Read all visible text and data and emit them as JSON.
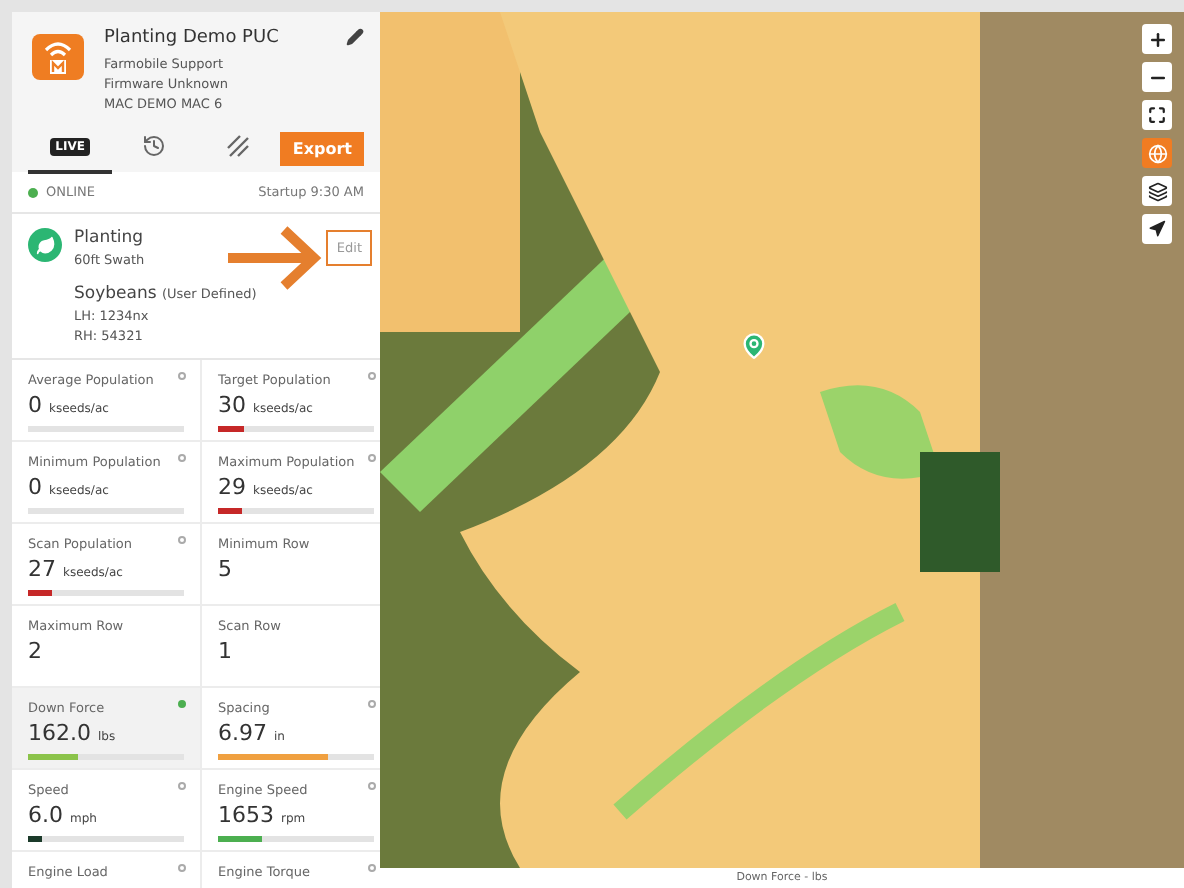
{
  "device": {
    "name": "Planting Demo PUC",
    "lines": [
      "Farmobile Support",
      "Firmware Unknown",
      "MAC DEMO MAC 6"
    ]
  },
  "tabs": [
    {
      "kind": "live",
      "label": "LIVE",
      "selected": true
    },
    {
      "kind": "history",
      "selected": false
    },
    {
      "kind": "coverage",
      "selected": false
    }
  ],
  "export_button": "Export",
  "status": {
    "online": true,
    "label": "ONLINE",
    "startup": "Startup 9:30 AM"
  },
  "operation": {
    "name": "Planting",
    "swath": "60ft Swath",
    "edit": "Edit",
    "crop": "Soybeans",
    "crop_note": "(User Defined)",
    "lines": [
      "LH: 1234nx",
      "RH: 54321"
    ]
  },
  "metrics": [
    {
      "kind": "empty_bar",
      "label": "Average Population",
      "value": "0",
      "unit": "kseeds/ac",
      "active": false,
      "selected": false
    },
    {
      "kind": "bar",
      "label": "Target Population",
      "value": "30",
      "unit": "kseeds/ac",
      "level": 0.17,
      "color": "#c62828",
      "active": false,
      "selected": false
    },
    {
      "kind": "empty_bar",
      "label": "Minimum Population",
      "value": "0",
      "unit": "kseeds/ac",
      "active": false,
      "selected": false
    },
    {
      "kind": "bar",
      "label": "Maximum Population",
      "value": "29",
      "unit": "kseeds/ac",
      "level": 0.16,
      "color": "#c62828",
      "active": false,
      "selected": false
    },
    {
      "kind": "bar",
      "label": "Scan Population",
      "value": "27",
      "unit": "kseeds/ac",
      "level": 0.15,
      "color": "#c62828",
      "active": false,
      "selected": false
    },
    {
      "kind": "plain",
      "label": "Minimum Row",
      "value": "5",
      "selected": false
    },
    {
      "kind": "plain",
      "label": "Maximum Row",
      "value": "2",
      "selected": false
    },
    {
      "kind": "plain",
      "label": "Scan Row",
      "value": "1",
      "selected": false
    },
    {
      "kind": "bar",
      "label": "Down Force",
      "value": "162.0",
      "unit": "lbs",
      "level": 0.32,
      "color": "#8bc34a",
      "active": true,
      "selected": true
    },
    {
      "kind": "bar",
      "label": "Spacing",
      "value": "6.97",
      "unit": "in",
      "level": 0.7,
      "color": "#f0a040",
      "active": false,
      "selected": false
    },
    {
      "kind": "bar",
      "label": "Speed",
      "value": "6.0",
      "unit": "mph",
      "level": 0.09,
      "color": "#1b3a2a",
      "active": false,
      "selected": false
    },
    {
      "kind": "bar",
      "label": "Engine Speed",
      "value": "1653",
      "unit": "rpm",
      "level": 0.28,
      "color": "#4caf50",
      "active": false,
      "selected": false
    },
    {
      "kind": "cut",
      "label": "Engine Load",
      "active": false,
      "selected": false
    },
    {
      "kind": "cut",
      "label": "Engine Torque",
      "active": false,
      "selected": false
    }
  ],
  "map_controls": [
    {
      "kind": "zoom-in",
      "selected": false
    },
    {
      "kind": "zoom-out",
      "selected": false
    },
    {
      "kind": "fullscreen",
      "selected": false
    },
    {
      "kind": "globe",
      "selected": true
    },
    {
      "kind": "layers",
      "selected": false
    },
    {
      "kind": "locate",
      "selected": false
    }
  ],
  "legend": "Down Force - lbs"
}
